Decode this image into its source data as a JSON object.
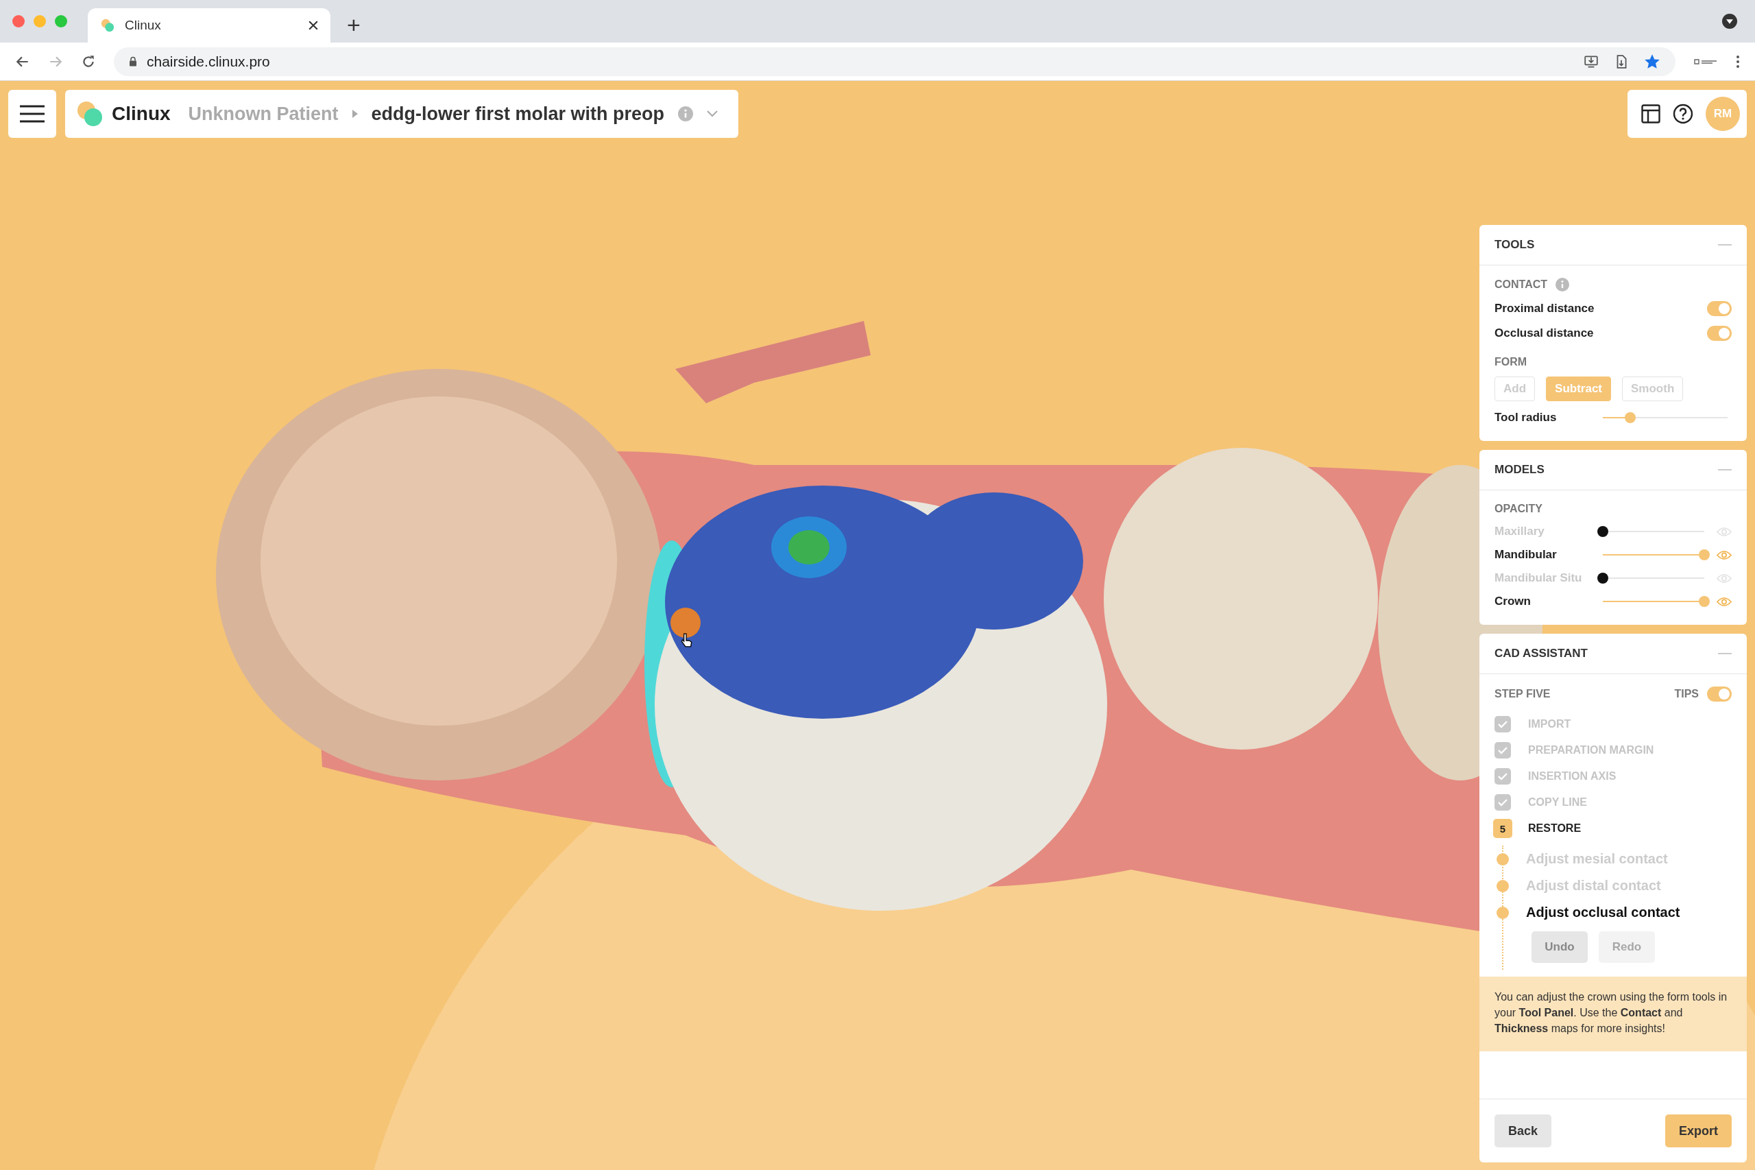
{
  "browser": {
    "tab_title": "Clinux",
    "new_tab": "+",
    "url": "chairside.clinux.pro"
  },
  "header": {
    "brand": "Clinux",
    "patient": "Unknown Patient",
    "case_title": "eddg-lower first molar with preop",
    "avatar": "RM"
  },
  "tools": {
    "title": "TOOLS",
    "contact_label": "CONTACT",
    "toggles": [
      {
        "label": "Proximal distance",
        "on": true
      },
      {
        "label": "Occlusal distance",
        "on": true
      }
    ],
    "form_label": "FORM",
    "form_buttons": [
      {
        "label": "Add",
        "selected": false
      },
      {
        "label": "Subtract",
        "selected": true
      },
      {
        "label": "Smooth",
        "selected": false
      }
    ],
    "tool_radius": {
      "label": "Tool radius",
      "level": 0.22
    }
  },
  "models": {
    "title": "MODELS",
    "opacity_label": "OPACITY",
    "items": [
      {
        "name": "Maxillary",
        "visible": false,
        "level": 0
      },
      {
        "name": "Mandibular",
        "visible": true,
        "level": 1
      },
      {
        "name": "Mandibular Situ",
        "visible": false,
        "level": 0
      },
      {
        "name": "Crown",
        "visible": true,
        "level": 1
      }
    ]
  },
  "cad_assistant": {
    "title": "CAD ASSISTANT",
    "step_label": "STEP FIVE",
    "tips": {
      "label": "TIPS",
      "on": true
    },
    "steps": [
      {
        "kind": "done",
        "label": "IMPORT"
      },
      {
        "kind": "done",
        "label": "PREPARATION MARGIN"
      },
      {
        "kind": "done",
        "label": "INSERTION AXIS"
      },
      {
        "kind": "done",
        "label": "COPY LINE"
      },
      {
        "kind": "current",
        "number": "5",
        "label": "RESTORE"
      }
    ],
    "substeps": [
      {
        "label": "Adjust mesial contact",
        "selected": false
      },
      {
        "label": "Adjust distal contact",
        "selected": false
      },
      {
        "label": "Adjust occlusal contact",
        "selected": true
      }
    ],
    "history_buttons": [
      {
        "label": "Undo",
        "disabled": false
      },
      {
        "label": "Redo",
        "disabled": true
      }
    ],
    "tip": "You can adjust the crown using the form tools in your **Tool Panel**. Use the **Contact** and **Thickness** maps for more insights!",
    "back": "Back",
    "export": "Export"
  }
}
